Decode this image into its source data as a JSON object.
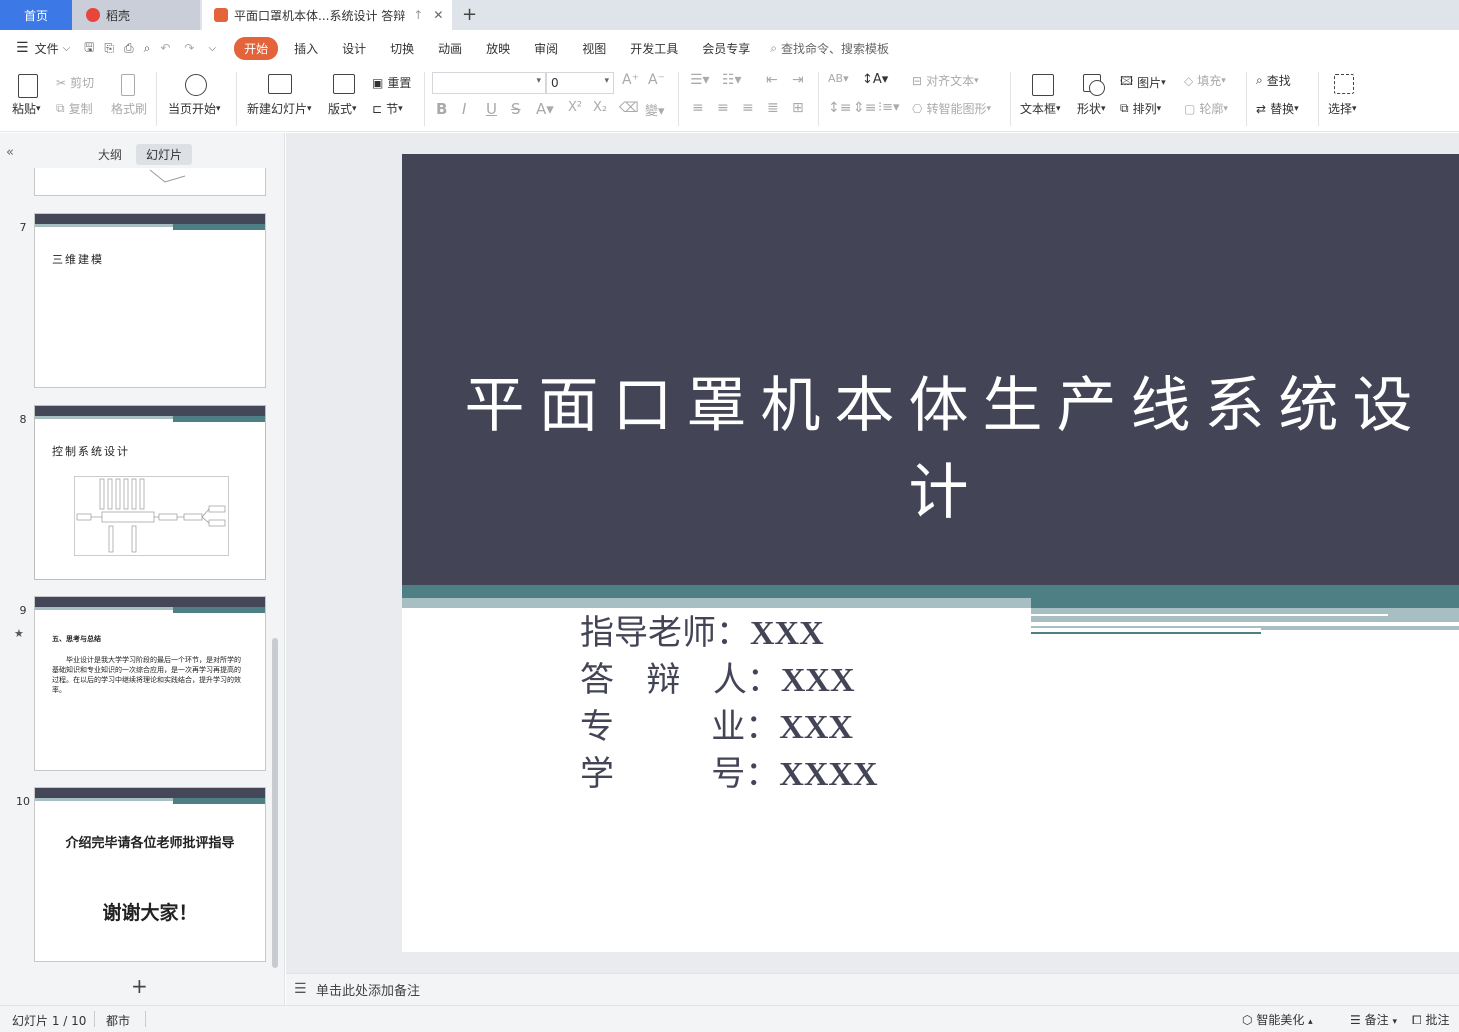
{
  "tabs": {
    "home": "首页",
    "daoke": "稻壳",
    "document": "平面口罩机本体...系统设计 答辩"
  },
  "menu": {
    "file": "文件",
    "items": [
      "开始",
      "插入",
      "设计",
      "切换",
      "动画",
      "放映",
      "审阅",
      "视图",
      "开发工具",
      "会员专享"
    ],
    "search_placeholder": "查找命令、搜索模板"
  },
  "ribbon": {
    "paste": "粘贴",
    "cut": "剪切",
    "copy": "复制",
    "format_painter": "格式刷",
    "from_current": "当页开始",
    "new_slide": "新建幻灯片",
    "layout": "版式",
    "reset": "重置",
    "section": "节",
    "font_size": "0",
    "align_text": "对齐文本",
    "smartart": "转智能图形",
    "textbox": "文本框",
    "shape": "形状",
    "picture": "图片",
    "arrange": "排列",
    "fill": "填充",
    "outline": "轮廓",
    "find": "查找",
    "replace": "替换",
    "select": "选择"
  },
  "panel": {
    "outline_tab": "大纲",
    "slides_tab": "幻灯片"
  },
  "thumbs": {
    "n7": "7",
    "t7": "三维建模",
    "n8": "8",
    "t8": "控制系统设计",
    "n9": "9",
    "t9_title": "五、思考与总结",
    "t9_body": "毕业设计是我大学学习阶段的最后一个环节，是对所学的基础知识和专业知识的一次综合应用，是一次再学习再提高的过程。在以后的学习中继续将理论和实践结合，提升学习的效率。",
    "n10": "10",
    "t10_line1": "介绍完毕请各位老师批评指导",
    "t10_line2": "谢谢大家！"
  },
  "slide": {
    "title": "平面口罩机本体生产线系统设计",
    "rows": [
      {
        "label": "指导老师：",
        "value": "XXX"
      },
      {
        "label": "答   辩   人：",
        "value": "XXX"
      },
      {
        "label": "专         业：",
        "value": "XXX"
      },
      {
        "label": "学         号：",
        "value": "XXXX"
      }
    ]
  },
  "notes_placeholder": "单击此处添加备注",
  "status": {
    "slide_counter": "幻灯片 1 / 10",
    "theme": "都市",
    "beautify": "智能美化",
    "notes": "备注",
    "comments": "批注"
  },
  "colors": {
    "accent": "#e3643a",
    "home_tab": "#3c79e6",
    "slide_dark": "#434556",
    "slide_teal": "#4e7f84",
    "slide_light_teal": "#a7bec2"
  }
}
